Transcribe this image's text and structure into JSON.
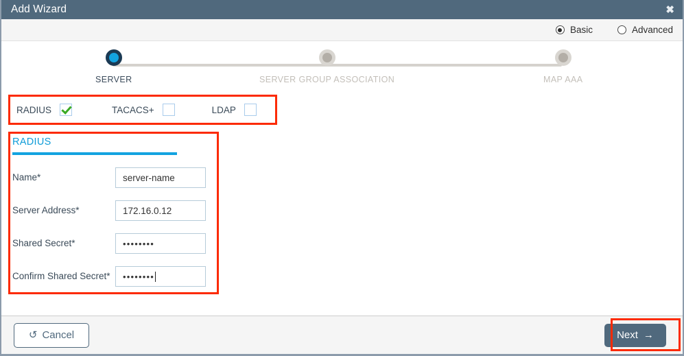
{
  "titlebar": {
    "title": "Add Wizard",
    "close_icon": "close-icon",
    "close_glyph": "✖"
  },
  "modebar": {
    "options": [
      {
        "label": "Basic",
        "selected": true
      },
      {
        "label": "Advanced",
        "selected": false
      }
    ]
  },
  "stepper": {
    "steps": [
      {
        "label": "SERVER",
        "state": "active"
      },
      {
        "label": "SERVER GROUP ASSOCIATION",
        "state": "inactive"
      },
      {
        "label": "MAP AAA",
        "state": "inactive"
      }
    ]
  },
  "protocols": [
    {
      "label": "RADIUS",
      "checked": true
    },
    {
      "label": "TACACS+",
      "checked": false
    },
    {
      "label": "LDAP",
      "checked": false
    }
  ],
  "form": {
    "tab_label": "RADIUS",
    "fields": [
      {
        "label": "Name*",
        "value": "server-name",
        "masked": false
      },
      {
        "label": "Server Address*",
        "value": "172.16.0.12",
        "masked": false
      },
      {
        "label": "Shared Secret*",
        "value": "••••••••",
        "masked": true
      },
      {
        "label": "Confirm Shared Secret*",
        "value": "••••••••",
        "masked": true,
        "focused": true
      }
    ]
  },
  "footer": {
    "cancel_label": "Cancel",
    "cancel_icon_glyph": "↺",
    "next_label": "Next",
    "next_icon_glyph": "→"
  },
  "colors": {
    "titlebar_bg": "#50697d",
    "accent_blue": "#13a3e0",
    "step_active": "#1b3a54",
    "step_inactive": "#b3aea7",
    "check_green": "#3aaa24",
    "annotation_red": "#fc2a00",
    "footer_bg": "#f5f5f5"
  }
}
